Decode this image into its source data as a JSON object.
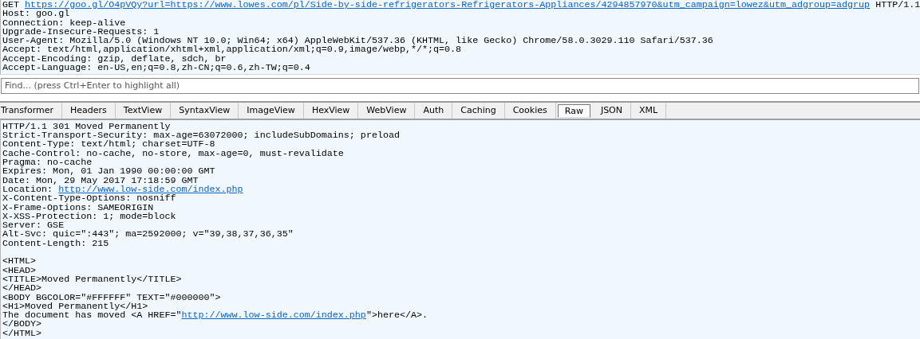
{
  "request": {
    "lines": [
      {
        "text": "GET ",
        "link": "https://goo.gl/O4pVQy?url=https://www.lowes.com/pl/Side-by-side-refrigerators-Refrigerators-Appliances/4294857970&utm_campaign=lowez&utm_adgroup=adgrup",
        "after": " HTTP/1.1"
      },
      {
        "text": "Host: goo.gl"
      },
      {
        "text": "Connection: keep-alive"
      },
      {
        "text": "Upgrade-Insecure-Requests: 1"
      },
      {
        "text": "User-Agent: Mozilla/5.0 (Windows NT 10.0; Win64; x64) AppleWebKit/537.36 (KHTML, like Gecko) Chrome/58.0.3029.110 Safari/537.36"
      },
      {
        "text": "Accept: text/html,application/xhtml+xml,application/xml;q=0.9,image/webp,*/*;q=0.8"
      },
      {
        "text": "Accept-Encoding: gzip, deflate, sdch, br"
      },
      {
        "text": "Accept-Language: en-US,en;q=0.8,zh-CN;q=0.6,zh-TW;q=0.4"
      }
    ]
  },
  "find": {
    "placeholder": "Find... (press Ctrl+Enter to highlight all)"
  },
  "tabs": [
    {
      "label": "Transformer",
      "selected": false
    },
    {
      "label": "Headers",
      "selected": false
    },
    {
      "label": "TextView",
      "selected": false
    },
    {
      "label": "SyntaxView",
      "selected": false
    },
    {
      "label": "ImageView",
      "selected": false
    },
    {
      "label": "HexView",
      "selected": false
    },
    {
      "label": "WebView",
      "selected": false
    },
    {
      "label": "Auth",
      "selected": false
    },
    {
      "label": "Caching",
      "selected": false
    },
    {
      "label": "Cookies",
      "selected": false
    },
    {
      "label": "Raw",
      "selected": true
    },
    {
      "label": "JSON",
      "selected": false
    },
    {
      "label": "XML",
      "selected": false
    }
  ],
  "response": {
    "headers": [
      {
        "text": "HTTP/1.1 301 Moved Permanently"
      },
      {
        "text": "Strict-Transport-Security: max-age=63072000; includeSubDomains; preload"
      },
      {
        "text": "Content-Type: text/html; charset=UTF-8"
      },
      {
        "text": "Cache-Control: no-cache, no-store, max-age=0, must-revalidate"
      },
      {
        "text": "Pragma: no-cache"
      },
      {
        "text": "Expires: Mon, 01 Jan 1990 00:00:00 GMT"
      },
      {
        "text": "Date: Mon, 29 May 2017 17:18:59 GMT"
      },
      {
        "text": "Location: ",
        "link": "http://www.low-side.com/index.php"
      },
      {
        "text": "X-Content-Type-Options: nosniff"
      },
      {
        "text": "X-Frame-Options: SAMEORIGIN"
      },
      {
        "text": "X-XSS-Protection: 1; mode=block"
      },
      {
        "text": "Server: GSE"
      },
      {
        "text": "Alt-Svc: quic=\":443\"; ma=2592000; v=\"39,38,37,36,35\""
      },
      {
        "text": "Content-Length: 215"
      }
    ],
    "body": [
      {
        "text": "<HTML>"
      },
      {
        "text": "<HEAD>"
      },
      {
        "text": "<TITLE>Moved Permanently</TITLE>"
      },
      {
        "text": "</HEAD>"
      },
      {
        "text": "<BODY BGCOLOR=\"#FFFFFF\" TEXT=\"#000000\">"
      },
      {
        "text": "<H1>Moved Permanently</H1>"
      },
      {
        "text": "The document has moved <A HREF=\"",
        "link": "http://www.low-side.com/index.php",
        "after": "\">here</A>."
      },
      {
        "text": "</BODY>"
      },
      {
        "text": "</HTML>"
      }
    ]
  }
}
